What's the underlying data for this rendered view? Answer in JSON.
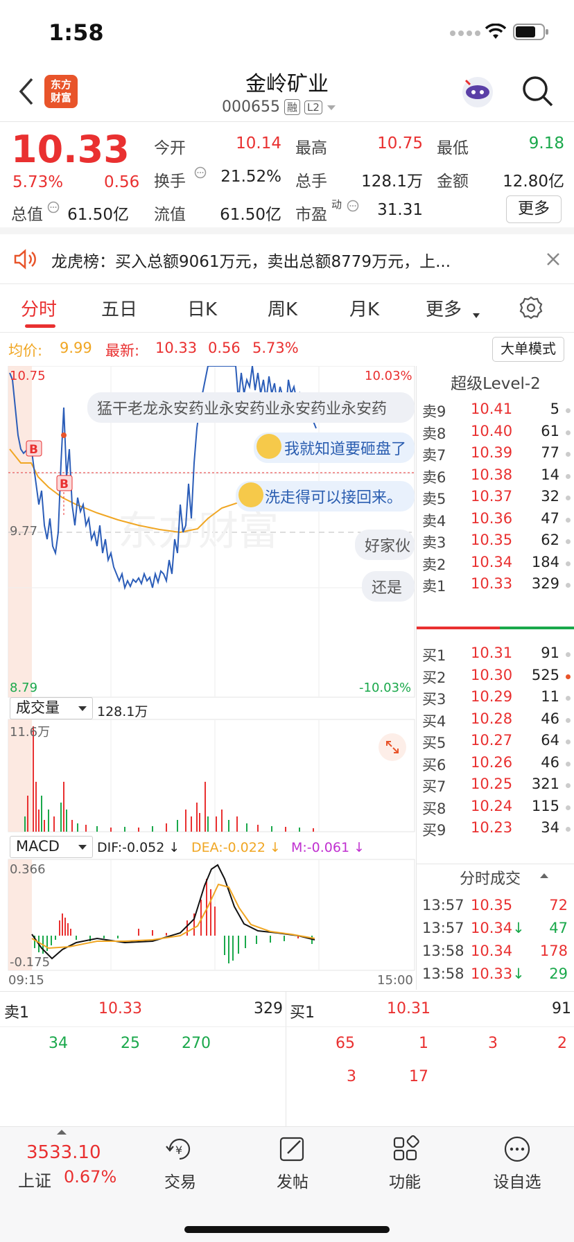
{
  "status": {
    "time": "1:58"
  },
  "header": {
    "title": "金岭矿业",
    "code": "000655",
    "tag1": "融",
    "tag2": "L2",
    "logo_line1": "东方",
    "logo_line2": "财富"
  },
  "quote": {
    "price": "10.33",
    "change_pct": "5.73%",
    "change": "0.56",
    "open_label": "今开",
    "open": "10.14",
    "high_label": "最高",
    "high": "10.75",
    "low_label": "最低",
    "low": "9.18",
    "turnover_label": "换手",
    "turnover": "21.52%",
    "volume_label": "总手",
    "volume": "128.1万",
    "amount_label": "金额",
    "amount": "12.80亿",
    "mktcap_label": "总值",
    "mktcap": "61.50亿",
    "float_label": "流值",
    "float_cap": "61.50亿",
    "pe_label": "市盈",
    "pe_sup": "动",
    "pe": "31.31",
    "more": "更多"
  },
  "notice": {
    "text": "龙虎榜：买入总额9061万元，卖出总额8779万元，上..."
  },
  "tabs": [
    "分时",
    "五日",
    "日K",
    "周K",
    "月K",
    "更多"
  ],
  "info": {
    "avg_label": "均价:",
    "avg": "9.99",
    "latest_label": "最新:",
    "latest": "10.33",
    "chg": "0.56",
    "pct": "5.73%",
    "mode": "大单模式"
  },
  "chart": {
    "ymax": "10.75",
    "ymid": "9.77",
    "ymin": "8.79",
    "pct_max": "10.03%",
    "pct_min": "-10.03%",
    "b_mark": "B",
    "watermark": "东方财富",
    "bubble1": "猛干老龙永安药业永安药业永安药业永安药",
    "bubble2": "我就知道要砸盘了",
    "bubble3": "洗走得可以接回来。",
    "bubble4": "好家伙",
    "bubble5": "还是",
    "vol_select": "成交量",
    "vol_total": "128.1万",
    "vol_max": "11.6万",
    "macd_select": "MACD",
    "dif": "DIF:-0.052 ↓",
    "dea": "DEA:-0.022 ↓",
    "m": "M:-0.061 ↓",
    "macd_max": "0.366",
    "macd_min": "-0.175",
    "t_start": "09:15",
    "t_end": "15:00",
    "colors": {
      "price": "#2b5db8",
      "avg": "#f0a623",
      "up": "#e93030",
      "down": "#1aa84b"
    }
  },
  "book": {
    "title": "超级Level-2",
    "asks": [
      {
        "l": "卖9",
        "p": "10.41",
        "v": "5"
      },
      {
        "l": "卖8",
        "p": "10.40",
        "v": "61"
      },
      {
        "l": "卖7",
        "p": "10.39",
        "v": "77"
      },
      {
        "l": "卖6",
        "p": "10.38",
        "v": "14"
      },
      {
        "l": "卖5",
        "p": "10.37",
        "v": "32"
      },
      {
        "l": "卖4",
        "p": "10.36",
        "v": "47"
      },
      {
        "l": "卖3",
        "p": "10.35",
        "v": "62"
      },
      {
        "l": "卖2",
        "p": "10.34",
        "v": "184"
      },
      {
        "l": "卖1",
        "p": "10.33",
        "v": "329"
      }
    ],
    "bids": [
      {
        "l": "买1",
        "p": "10.31",
        "v": "91"
      },
      {
        "l": "买2",
        "p": "10.30",
        "v": "525"
      },
      {
        "l": "买3",
        "p": "10.29",
        "v": "11"
      },
      {
        "l": "买4",
        "p": "10.28",
        "v": "46"
      },
      {
        "l": "买5",
        "p": "10.27",
        "v": "64"
      },
      {
        "l": "买6",
        "p": "10.26",
        "v": "46"
      },
      {
        "l": "买7",
        "p": "10.25",
        "v": "321"
      },
      {
        "l": "买8",
        "p": "10.24",
        "v": "115"
      },
      {
        "l": "买9",
        "p": "10.23",
        "v": "34"
      }
    ],
    "ticks_title": "分时成交",
    "ticks": [
      {
        "t": "13:57",
        "p": "10.35",
        "arrow": "",
        "v": "72",
        "vc": "red"
      },
      {
        "t": "13:57",
        "p": "10.34",
        "arrow": "↓",
        "v": "47",
        "vc": "green"
      },
      {
        "t": "13:58",
        "p": "10.34",
        "arrow": "",
        "v": "178",
        "vc": "red"
      },
      {
        "t": "13:58",
        "p": "10.33",
        "arrow": "↓",
        "v": "29",
        "vc": "green"
      }
    ]
  },
  "queue": {
    "sell_label": "卖1",
    "sell_price": "10.33",
    "sell_vol": "329",
    "buy_label": "买1",
    "buy_price": "10.31",
    "buy_vol": "91",
    "sell_orders": [
      "34",
      "25",
      "270"
    ],
    "buy_orders": [
      "65",
      "1",
      "3",
      "2",
      "3",
      "17"
    ]
  },
  "bottom": {
    "index_value": "3533.10",
    "index_name": "上证",
    "index_pct": "0.67%",
    "items": [
      "交易",
      "发帖",
      "功能",
      "设自选"
    ]
  }
}
